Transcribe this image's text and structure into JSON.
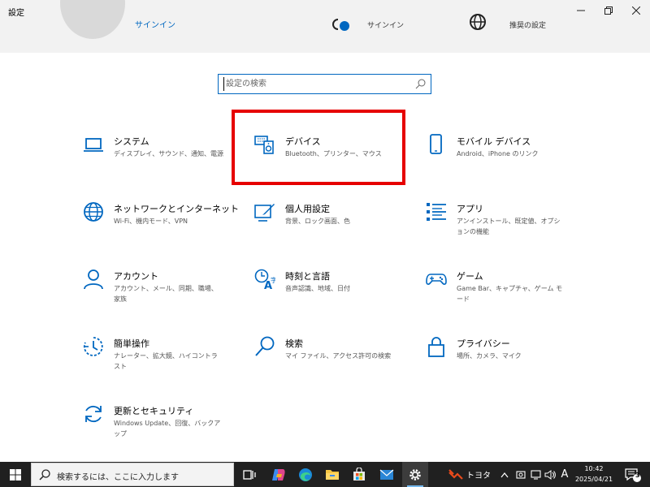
{
  "window": {
    "title": "設定"
  },
  "header": {
    "signin_link": "サインイン",
    "signin_text": "サインイン",
    "recommended_text": "推奨の設定"
  },
  "search": {
    "placeholder": "設定の検索"
  },
  "categories": [
    {
      "title": "システム",
      "desc": "ディスプレイ、サウンド、通知、電源",
      "icon": "laptop-icon"
    },
    {
      "title": "デバイス",
      "desc": "Bluetooth、プリンター、マウス",
      "icon": "keyboard-speaker-icon"
    },
    {
      "title": "モバイル デバイス",
      "desc": "Android、iPhone のリンク",
      "icon": "phone-icon"
    },
    {
      "title": "ネットワークとインターネット",
      "desc": "Wi-Fi、機内モード、VPN",
      "icon": "globe-icon"
    },
    {
      "title": "個人用設定",
      "desc": "背景、ロック画面、色",
      "icon": "paint-brush-icon"
    },
    {
      "title": "アプリ",
      "desc": "アンインストール、既定値、オプションの機能",
      "icon": "apps-list-icon"
    },
    {
      "title": "アカウント",
      "desc": "アカウント、メール、同期、職場、家族",
      "icon": "person-icon"
    },
    {
      "title": "時刻と言語",
      "desc": "音声認識、地域、日付",
      "icon": "time-language-icon"
    },
    {
      "title": "ゲーム",
      "desc": "Game Bar、キャプチャ、ゲーム モード",
      "icon": "gamepad-icon"
    },
    {
      "title": "簡単操作",
      "desc": "ナレーター、拡大鏡、ハイコントラスト",
      "icon": "ease-of-access-icon"
    },
    {
      "title": "検索",
      "desc": "マイ ファイル、アクセス許可の検索",
      "icon": "search-icon"
    },
    {
      "title": "プライバシー",
      "desc": "場所、カメラ、マイク",
      "icon": "lock-icon"
    },
    {
      "title": "更新とセキュリティ",
      "desc": "Windows Update、回復、バックアップ",
      "icon": "refresh-icon"
    }
  ],
  "taskbar": {
    "search_text": "検索するには、ここに入力します",
    "stock_text": "トヨタ",
    "ime": "A",
    "time": "10:42",
    "date": "2025/04/21",
    "notifications": "3"
  }
}
